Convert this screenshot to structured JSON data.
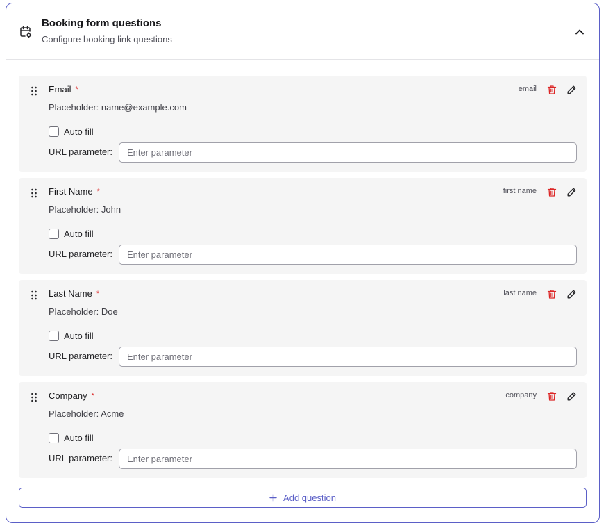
{
  "colors": {
    "accent": "#5b5fc7",
    "required": "#dc2626",
    "delete": "#dc2626",
    "card_bg": "#f5f5f5"
  },
  "header": {
    "title": "Booking form questions",
    "subtitle": "Configure booking link questions",
    "icon": "calendar-settings-icon",
    "collapse_icon": "chevron-up-icon"
  },
  "questions": [
    {
      "label": "Email",
      "required_mark": "*",
      "key": "email",
      "placeholder_text": "Placeholder: name@example.com",
      "autofill_label": "Auto fill",
      "autofill_checked": false,
      "url_label": "URL parameter:",
      "url_placeholder": "Enter parameter",
      "url_value": ""
    },
    {
      "label": "First Name",
      "required_mark": "*",
      "key": "first name",
      "placeholder_text": "Placeholder: John",
      "autofill_label": "Auto fill",
      "autofill_checked": false,
      "url_label": "URL parameter:",
      "url_placeholder": "Enter parameter",
      "url_value": ""
    },
    {
      "label": "Last Name",
      "required_mark": "*",
      "key": "last name",
      "placeholder_text": "Placeholder: Doe",
      "autofill_label": "Auto fill",
      "autofill_checked": false,
      "url_label": "URL parameter:",
      "url_placeholder": "Enter parameter",
      "url_value": ""
    },
    {
      "label": "Company",
      "required_mark": "*",
      "key": "company",
      "placeholder_text": "Placeholder: Acme",
      "autofill_label": "Auto fill",
      "autofill_checked": false,
      "url_label": "URL parameter:",
      "url_placeholder": "Enter parameter",
      "url_value": ""
    }
  ],
  "add_button": {
    "label": "Add question",
    "icon": "plus-icon"
  }
}
